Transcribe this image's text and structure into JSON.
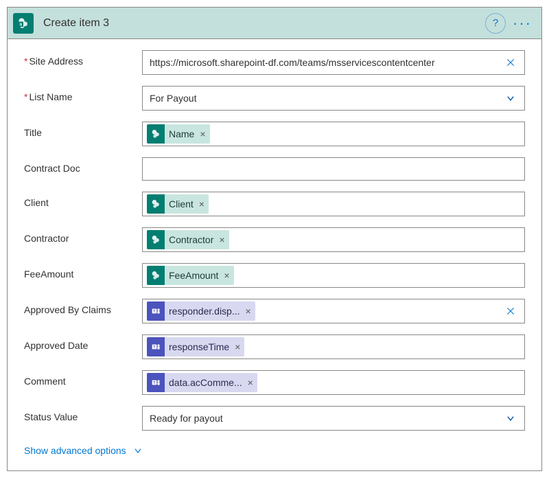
{
  "header": {
    "title": "Create item 3"
  },
  "fields": {
    "siteAddress": {
      "label": "Site Address",
      "value": "https://microsoft.sharepoint-df.com/teams/msservicescontentcenter"
    },
    "listName": {
      "label": "List Name",
      "value": "For Payout"
    },
    "title": {
      "label": "Title",
      "token": "Name"
    },
    "contractDoc": {
      "label": "Contract Doc",
      "value": ""
    },
    "client": {
      "label": "Client",
      "token": "Client"
    },
    "contractor": {
      "label": "Contractor",
      "token": "Contractor"
    },
    "feeAmount": {
      "label": "FeeAmount",
      "token": "FeeAmount"
    },
    "approvedBy": {
      "label": "Approved By Claims",
      "token": "responder.disp..."
    },
    "approvedDate": {
      "label": "Approved Date",
      "token": "responseTime"
    },
    "comment": {
      "label": "Comment",
      "token": "data.acComme..."
    },
    "statusValue": {
      "label": "Status Value",
      "value": "Ready for payout"
    }
  },
  "footer": {
    "advanced": "Show advanced options"
  }
}
